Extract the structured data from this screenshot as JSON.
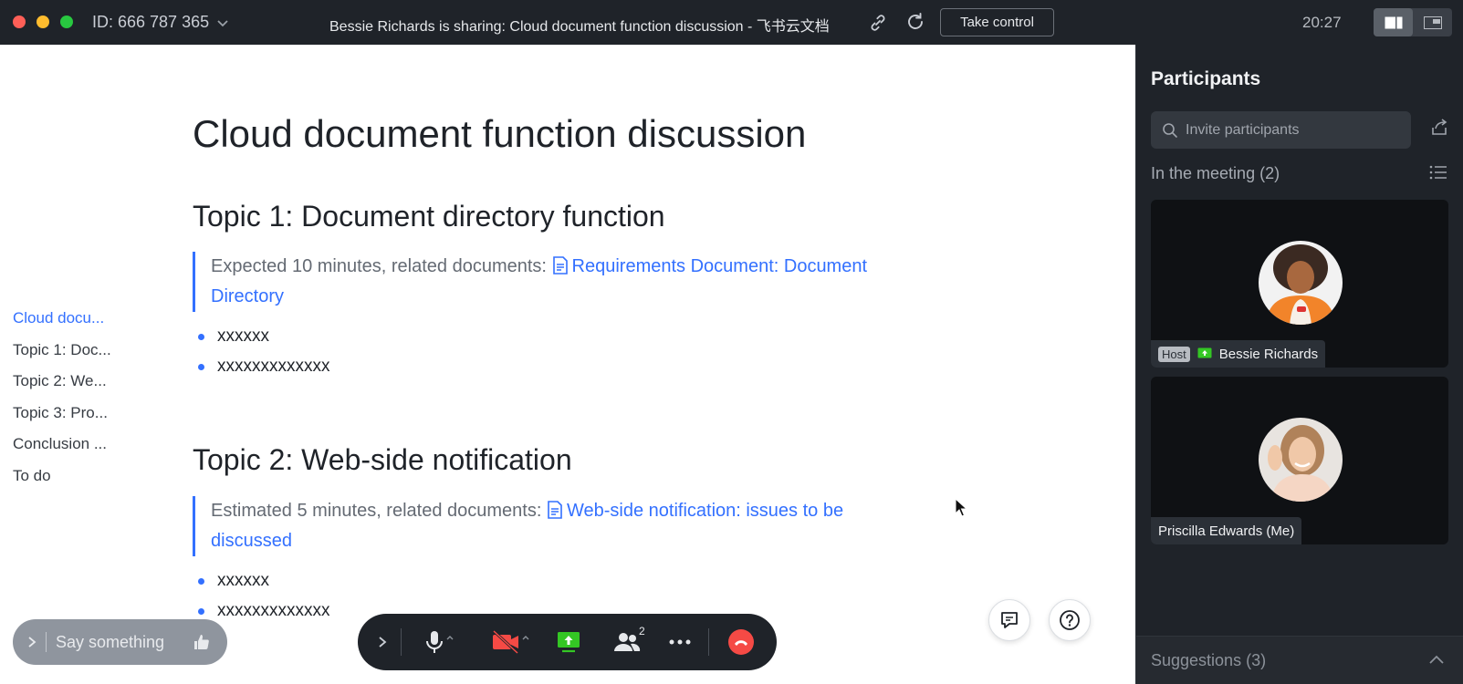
{
  "titlebar": {
    "meeting_id": "ID: 666 787 365",
    "sharing_title": "Bessie Richards is sharing: Cloud document function discussion - 飞书云文档",
    "take_control_label": "Take control",
    "clock": "20:27"
  },
  "toc": {
    "items": [
      {
        "label": "Cloud docu..."
      },
      {
        "label": "Topic 1: Doc..."
      },
      {
        "label": "Topic 2: We..."
      },
      {
        "label": "Topic 3: Pro..."
      },
      {
        "label": "Conclusion ..."
      },
      {
        "label": "To do"
      }
    ]
  },
  "document": {
    "title": "Cloud document function discussion",
    "topic1": {
      "heading": "Topic 1: Document directory function",
      "quote_prefix": "Expected 10 minutes, related documents: ",
      "quote_link": "Requirements Document: Document Directory",
      "bullets": [
        "xxxxxx",
        "xxxxxxxxxxxxx"
      ]
    },
    "topic2": {
      "heading": "Topic 2: Web-side notification",
      "quote_prefix": "Estimated 5 minutes, related documents: ",
      "quote_link": "Web-side notification: issues to be discussed",
      "bullets": [
        "xxxxxx",
        "xxxxxxxxxxxxx"
      ]
    }
  },
  "chat_bar": {
    "placeholder": "Say something"
  },
  "controls": {
    "participants_count": "2"
  },
  "panel": {
    "title": "Participants",
    "invite_placeholder": "Invite participants",
    "in_meeting_label": "In the meeting (2)",
    "participants": [
      {
        "name": "Bessie Richards",
        "tag": "Host"
      },
      {
        "name": "Priscilla Edwards (Me)"
      }
    ],
    "suggestions_label": "Suggestions (3)"
  },
  "colors": {
    "accent": "#3370ff",
    "end_call": "#f54a45",
    "share_green": "#34c724",
    "video_off_red": "#f54a45"
  }
}
